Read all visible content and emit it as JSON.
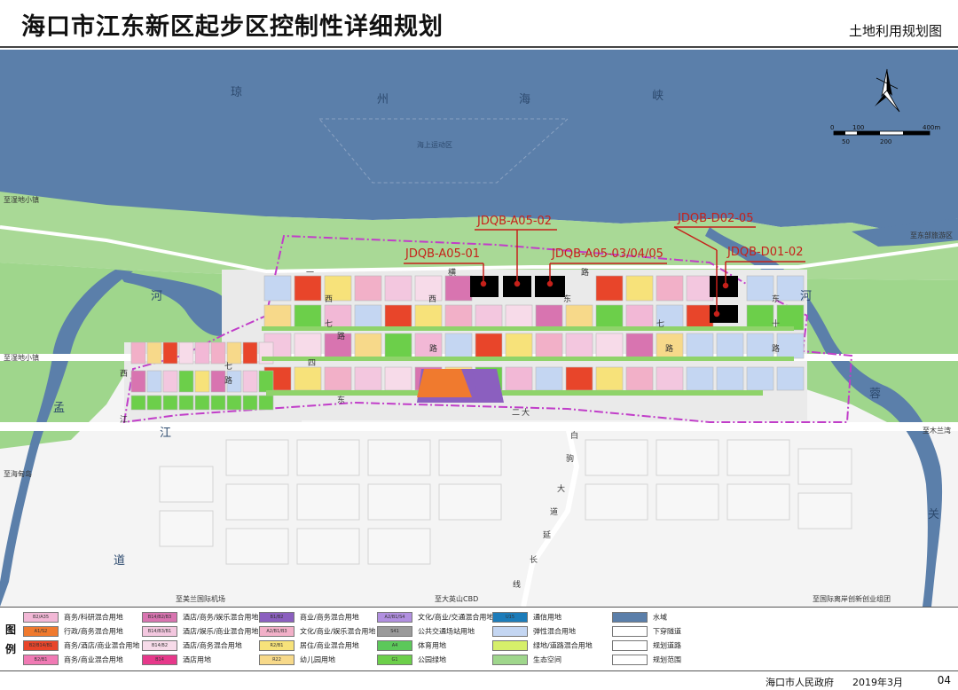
{
  "title": "海口市江东新区起步区控制性详细规划",
  "subtitle": "土地利用规划图",
  "sea": {
    "chars": [
      "琼",
      "州",
      "海",
      "峡"
    ],
    "zone_label": "海上运动区"
  },
  "river_left": {
    "chars": [
      "河",
      "道"
    ]
  },
  "river_right": {
    "chars": [
      "河",
      "蓉",
      "关"
    ]
  },
  "river_left2": {
    "chars": [
      "孟",
      "江"
    ]
  },
  "scale": {
    "ticks_top": [
      "0",
      "100",
      "400m"
    ],
    "ticks_bottom": [
      "50",
      "200"
    ]
  },
  "edge_labels": {
    "to_shidi_top": "至湿地小镇",
    "to_shidi_mid": "至湿地小镇",
    "to_haidian": "至海甸岛",
    "to_east_tour": "至东部旅游区",
    "to_mulan": "至木兰湾",
    "to_airport": "至美兰国际机场",
    "to_cbd": "至大英山CBD",
    "to_innovation": "至国际离岸创新创业组团"
  },
  "road_chars": {
    "north": [
      "一",
      "横",
      "路"
    ],
    "east": [
      "东",
      "十",
      "路"
    ],
    "west_west": [
      "西",
      "七",
      "路"
    ],
    "middle": [
      "西",
      "四",
      "路"
    ],
    "east_mid": [
      "东",
      "七",
      "路"
    ],
    "second_east": [
      "二",
      "大"
    ],
    "trunk": [
      "白",
      "驹",
      "大",
      "道",
      "延",
      "长",
      "线"
    ],
    "west_left": [
      "西",
      "七",
      "路"
    ],
    "south": [
      "东",
      "江"
    ]
  },
  "callouts": [
    {
      "id": "a0501",
      "text": "JDQB-A05-01"
    },
    {
      "id": "a0502",
      "text": "JDQB-A05-02"
    },
    {
      "id": "a0503",
      "text": "JDQB-A05-03/04/05"
    },
    {
      "id": "d0205",
      "text": "JDQB-D02-05"
    },
    {
      "id": "d0102",
      "text": "JDQB-D01-02"
    }
  ],
  "legend": {
    "title": "图例",
    "items": [
      {
        "code": "B2/A35",
        "label": "商务/科研混合用地",
        "color": "#f2b8d6"
      },
      {
        "code": "A1/S2",
        "label": "行政/商务混合用地",
        "color": "#f07a2e"
      },
      {
        "code": "B2/B14/B1",
        "label": "商务/酒店/商业混合用地",
        "color": "#e8452a"
      },
      {
        "code": "B2/B1",
        "label": "商务/商业混合用地",
        "color": "#f07ab4"
      },
      {
        "code": "B14/B2/B3",
        "label": "酒店/商务/娱乐混合用地",
        "color": "#d874b0"
      },
      {
        "code": "B14/B3/B1",
        "label": "酒店/娱乐/商业混合用地",
        "color": "#f3c7df"
      },
      {
        "code": "B14/B2",
        "label": "酒店/商务混合用地",
        "color": "#f7dbe9"
      },
      {
        "code": "B14",
        "label": "酒店用地",
        "color": "#e6388a"
      },
      {
        "code": "B1/B2",
        "label": "商业/商务混合用地",
        "color": "#8b5fbf"
      },
      {
        "code": "A2/B1/B3",
        "label": "文化/商业/娱乐混合用地",
        "color": "#f2b0c8"
      },
      {
        "code": "R2/B1",
        "label": "居住/商业混合用地",
        "color": "#f7e27a"
      },
      {
        "code": "R22",
        "label": "幼儿园用地",
        "color": "#f7d98a"
      },
      {
        "code": "A2/B1/S4",
        "label": "文化/商业/交通混合用地",
        "color": "#b18fe0"
      },
      {
        "code": "S41",
        "label": "公共交通场站用地",
        "color": "#9a9a9a"
      },
      {
        "code": "A4",
        "label": "体育用地",
        "color": "#5cc85a"
      },
      {
        "code": "G1",
        "label": "公园绿地",
        "color": "#6ccf4a"
      },
      {
        "code": "U15",
        "label": "通信用地",
        "color": "#1c7cba"
      },
      {
        "code": "",
        "label": "弹性混合用地",
        "color": "#c4d6f2"
      },
      {
        "code": "",
        "label": "绿地/道路混合用地",
        "color": "#d6ef6a"
      },
      {
        "code": "",
        "label": "生态空间",
        "color": "#9fd68c"
      },
      {
        "code": "",
        "label": "水域",
        "color": "#5b7faa"
      },
      {
        "code": "",
        "label": "下穿隧道",
        "color": "#ffffff"
      },
      {
        "code": "",
        "label": "规划道路",
        "color": "#ffffff"
      },
      {
        "code": "",
        "label": "规划范围",
        "color": "#ffffff"
      }
    ]
  },
  "footer": {
    "gov": "海口市人民政府",
    "date": "2019年3月",
    "page": "04"
  }
}
